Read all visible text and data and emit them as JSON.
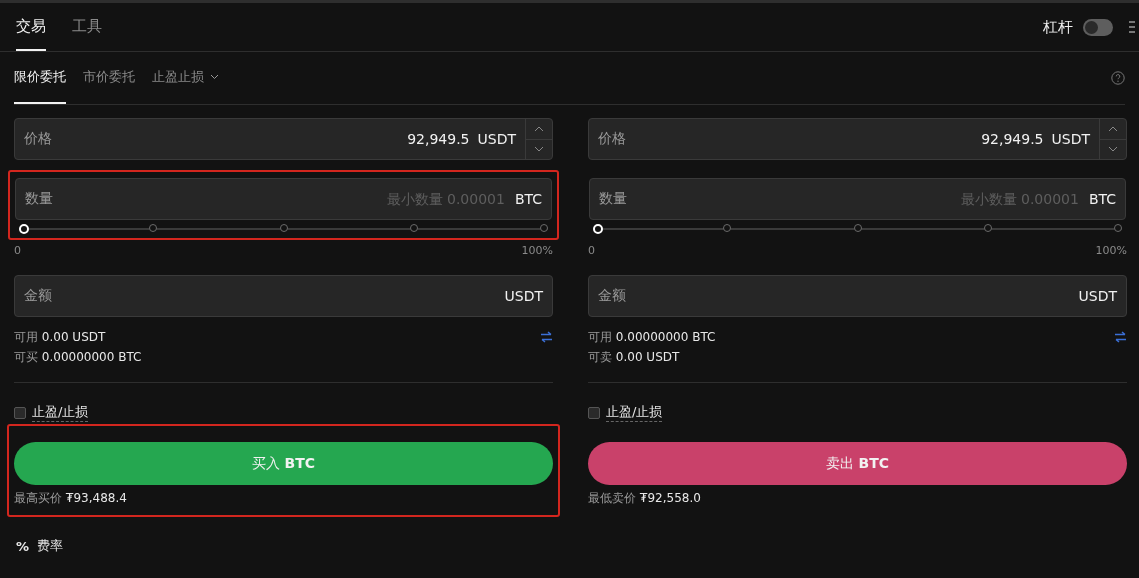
{
  "tabs": [
    {
      "label": "交易",
      "selected": true
    },
    {
      "label": "工具",
      "selected": false
    }
  ],
  "leverage": {
    "label": "杠杆",
    "on": false
  },
  "order_tabs": [
    {
      "label": "限价委托",
      "selected": true,
      "kind": "tab"
    },
    {
      "label": "市价委托",
      "selected": false,
      "kind": "tab"
    },
    {
      "label": "止盈止损",
      "selected": false,
      "kind": "dropdown"
    }
  ],
  "panels": [
    {
      "kind": "buy",
      "price": {
        "label": "价格",
        "value": "92,949.5",
        "unit": "USDT"
      },
      "quantity": {
        "label": "数量",
        "placeholder": "最小数量 0.00001",
        "unit": "BTC",
        "highlighted": true
      },
      "slider": {
        "level": 0,
        "min_label": "0",
        "max_label": "100%"
      },
      "amount": {
        "label": "金额",
        "unit": "USDT"
      },
      "available": {
        "label": "可用",
        "value": "0.00 USDT"
      },
      "max": {
        "label": "可买",
        "value": "0.00000000 BTC"
      },
      "tpsl": {
        "label": "止盈/止损",
        "checked": false
      },
      "action": {
        "label": "买入 **BTC**",
        "highlighted": true
      },
      "best_price": {
        "label": "最高买价",
        "value": "₮93,488.4"
      }
    },
    {
      "kind": "sell",
      "price": {
        "label": "价格",
        "value": "92,949.5",
        "unit": "USDT"
      },
      "quantity": {
        "label": "数量",
        "placeholder": "最小数量 0.00001",
        "unit": "BTC",
        "highlighted": false
      },
      "slider": {
        "level": 0,
        "min_label": "0",
        "max_label": "100%"
      },
      "amount": {
        "label": "金额",
        "unit": "USDT"
      },
      "available": {
        "label": "可用",
        "value": "0.00000000 BTC"
      },
      "max": {
        "label": "可卖",
        "value": "0.00 USDT"
      },
      "tpsl": {
        "label": "止盈/止损",
        "checked": false
      },
      "action": {
        "label": "卖出 **BTC**",
        "highlighted": false
      },
      "best_price": {
        "label": "最低卖价",
        "value": "₮92,558.0"
      }
    }
  ],
  "fee": {
    "icon": "%",
    "label": "费率"
  }
}
